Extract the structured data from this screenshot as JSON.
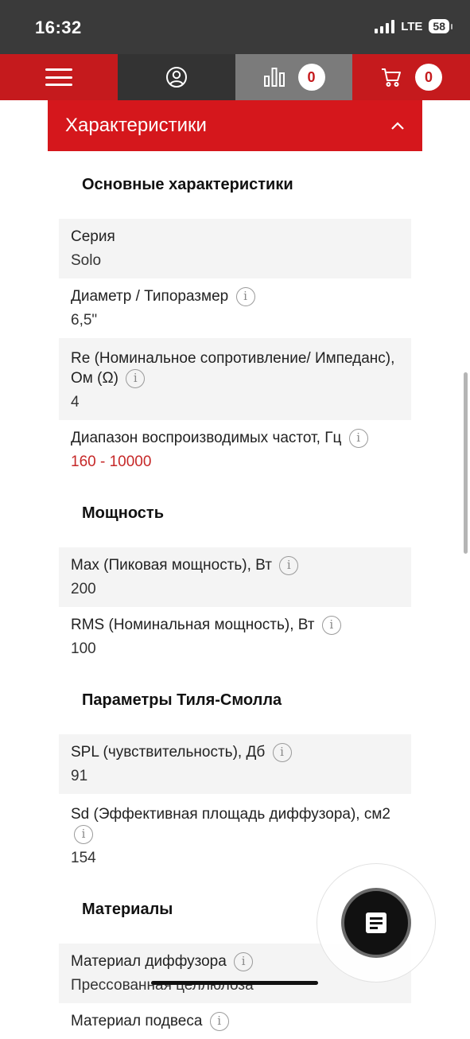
{
  "status_bar": {
    "time": "16:32",
    "network": "LTE",
    "battery": "58"
  },
  "nav": {
    "compare_count": "0",
    "cart_count": "0"
  },
  "section": {
    "title": "Характеристики"
  },
  "groups": [
    {
      "title": "Основные характеристики",
      "rows": [
        {
          "label": "Серия",
          "value": "Solo",
          "info": false
        },
        {
          "label": "Диаметр / Типоразмер",
          "value": "6,5\"",
          "info": true
        },
        {
          "label": "Re (Номинальное сопротивление/ Импеданс), Ом (Ω)",
          "value": "4",
          "info": true
        },
        {
          "label": "Диапазон воспроизводимых частот, Гц",
          "value": "160 - 10000",
          "info": true,
          "value_color": "#c62828"
        }
      ]
    },
    {
      "title": "Мощность",
      "rows": [
        {
          "label": "Max (Пиковая мощность), Вт",
          "value": "200",
          "info": true
        },
        {
          "label": "RMS (Номинальная мощность), Вт",
          "value": "100",
          "info": true
        }
      ]
    },
    {
      "title": "Параметры Тиля-Смолла",
      "rows": [
        {
          "label": "SPL (чувствительность), Дб",
          "value": "91",
          "info": true
        },
        {
          "label": "Sd (Эффективная площадь диффузора), см2",
          "value": "154",
          "info": true
        }
      ]
    },
    {
      "title": "Материалы",
      "rows": [
        {
          "label": "Материал диффузора",
          "value": "Прессованная целлюлоза",
          "info": true
        },
        {
          "label": "Материал подвеса",
          "value": "",
          "info": true
        }
      ]
    }
  ],
  "icons": {
    "menu": "hamburger-icon",
    "account": "user-icon",
    "compare": "bar-chart-icon",
    "cart": "cart-icon",
    "collapse": "chevron-up-icon",
    "info": "info-icon",
    "fab": "document-icon"
  },
  "colors": {
    "brand_red": "#d5171c",
    "accent_red_text": "#c62828",
    "nav_dark": "#333333",
    "nav_gray": "#7b7b7b"
  }
}
